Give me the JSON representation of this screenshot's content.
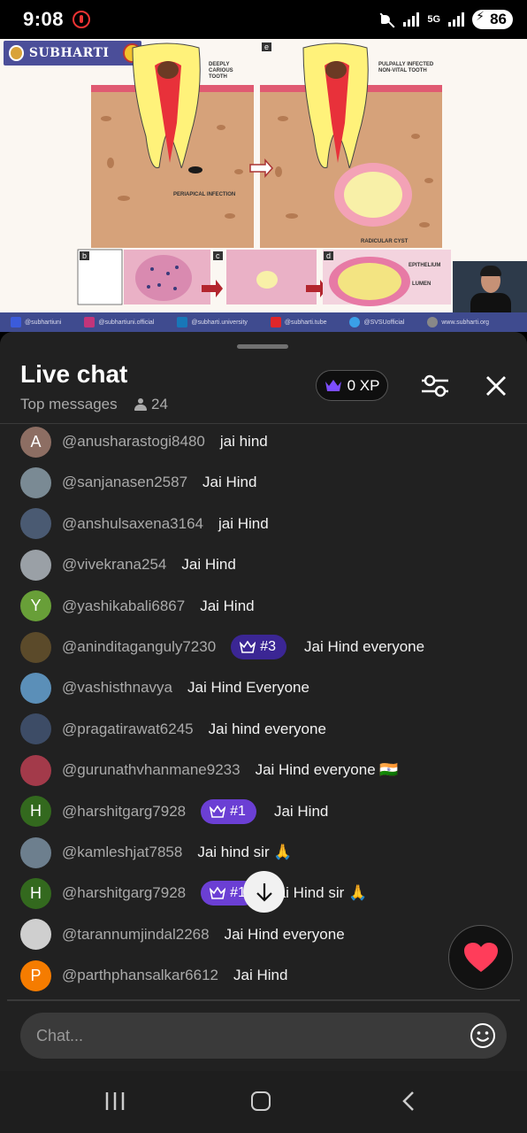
{
  "status_bar": {
    "time": "9:08",
    "network": "5G",
    "battery": "86"
  },
  "video": {
    "logo_text": "SUBHARTI",
    "panel_labels": [
      "e",
      "b",
      "c",
      "d"
    ],
    "labels": {
      "deeply_carious": "DEEPLY CARIOUS TOOTH",
      "pulpally_infected": "PULPALLY INFECTED NON-VITAL TOOTH",
      "periapical": "PERIAPICAL INFECTION",
      "radicular_cyst": "RADICULAR CYST",
      "epithelium": "EPITHELIUM",
      "lumen": "LUMEN"
    },
    "social": [
      "@subhartiuni",
      "@subhartiuni.official",
      "@subharti.university",
      "@subharti.tube",
      "@SVSUofficial",
      "www.subharti.org"
    ]
  },
  "chat": {
    "title": "Live chat",
    "subtitle": "Top messages",
    "viewer_count": "24",
    "xp_label": "0 XP",
    "input_placeholder": "Chat...",
    "colors": {
      "panel": "#212121",
      "badge": "#6b3fd4",
      "badge_dark": "#3b2694"
    },
    "messages": [
      {
        "author": "@anusharastogi8480",
        "text": "jai hind",
        "initial": "A",
        "avatar_color": "#8d6e63",
        "badge": ""
      },
      {
        "author": "@sanjanasen2587",
        "text": "Jai Hind",
        "initial": "",
        "avatar_color": "#7a8a94",
        "badge": ""
      },
      {
        "author": "@anshulsaxena3164",
        "text": "jai Hind",
        "initial": "",
        "avatar_color": "#4a5a72",
        "badge": ""
      },
      {
        "author": "@vivekrana254",
        "text": "Jai Hind",
        "initial": "",
        "avatar_color": "#9aa0a6",
        "badge": ""
      },
      {
        "author": "@yashikabali6867",
        "text": "Jai Hind",
        "initial": "Y",
        "avatar_color": "#689f38",
        "badge": ""
      },
      {
        "author": "@aninditaganguly7230",
        "text": "Jai Hind everyone",
        "initial": "",
        "avatar_color": "#5b4a2a",
        "badge": "#3",
        "badge_style": "dark"
      },
      {
        "author": "@vashisthnavya",
        "text": "Jai Hind Everyone",
        "initial": "",
        "avatar_color": "#5b8fb8",
        "badge": ""
      },
      {
        "author": "@pragatirawat6245",
        "text": "Jai hind everyone",
        "initial": "",
        "avatar_color": "#3d4c66",
        "badge": ""
      },
      {
        "author": "@gurunathvhanmane9233",
        "text": "Jai Hind everyone 🇮🇳",
        "initial": "",
        "avatar_color": "#a33a4a",
        "badge": ""
      },
      {
        "author": "@harshitgarg7928",
        "text": "Jai Hind",
        "initial": "H",
        "avatar_color": "#33691e",
        "badge": "#1",
        "badge_style": "light"
      },
      {
        "author": "@kamleshjat7858",
        "text": "Jai hind sir 🙏",
        "initial": "",
        "avatar_color": "#6d7f8e",
        "badge": ""
      },
      {
        "author": "@harshitgarg7928",
        "text": "jai Hind sir 🙏",
        "initial": "H",
        "avatar_color": "#33691e",
        "badge": "#1",
        "badge_style": "light"
      },
      {
        "author": "@tarannumjindal2268",
        "text": "Jai Hind everyone",
        "initial": "",
        "avatar_color": "#cfcfcf",
        "badge": ""
      },
      {
        "author": "@parthphansalkar6612",
        "text": "Jai Hind",
        "initial": "P",
        "avatar_color": "#f57c00",
        "badge": ""
      }
    ]
  }
}
